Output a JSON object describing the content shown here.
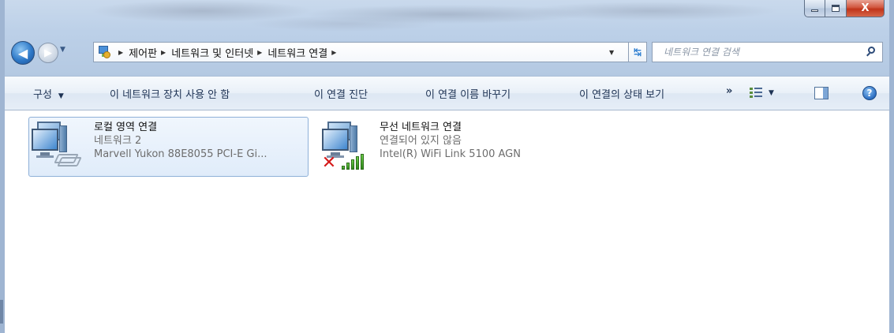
{
  "window": {
    "caption": {
      "minimize": "▬",
      "maximize": "☐",
      "close": "X"
    }
  },
  "nav": {
    "breadcrumbs": [
      "제어판",
      "네트워크 및 인터넷",
      "네트워크 연결"
    ],
    "search_placeholder": "네트워크 연결 검색"
  },
  "toolbar": {
    "organize": "구성",
    "disable_device": "이 네트워크 장치 사용 안 함",
    "diagnose": "이 연결 진단",
    "rename": "이 연결 이름 바꾸기",
    "view_status": "이 연결의 상태 보기",
    "more": "»",
    "help": "?"
  },
  "connections": [
    {
      "name": "로컬 영역 연결",
      "status": "네트워크  2",
      "device": "Marvell Yukon 88E8055 PCI-E Gi...",
      "type": "ethernet",
      "selected": true
    },
    {
      "name": "무선 네트워크 연결",
      "status": "연결되어 있지 않음",
      "device": "Intel(R) WiFi Link 5100 AGN",
      "type": "wireless",
      "selected": false,
      "status_icon": "red-x-icon"
    }
  ],
  "colors": {
    "selection_border": "#8eb0d8",
    "close_button": "#c0341a",
    "wireless_signal": "#3fa224",
    "disconnected_mark": "#d51b1b"
  }
}
